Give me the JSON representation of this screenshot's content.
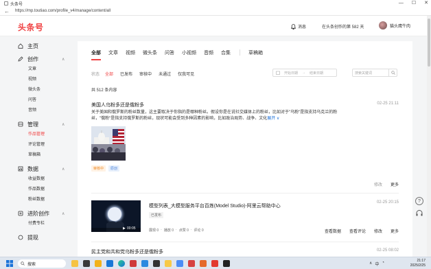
{
  "browser": {
    "tab_title": "头条号",
    "url": "https://mp.toutiao.com/profile_v4/manage/content/all",
    "controls": [
      "—",
      "☐",
      "✕"
    ]
  },
  "header": {
    "logo": "头条号",
    "messages": "消息",
    "days_text": "在头条创作的第 582 天",
    "username": "猫头鹰牛肉"
  },
  "sidebar": {
    "home": "主页",
    "create": {
      "label": "创作",
      "items": [
        "文章",
        "视频",
        "微头条",
        "问答",
        "音频"
      ]
    },
    "manage": {
      "label": "管理",
      "items": [
        "作品管理",
        "评论管理",
        "草稿箱"
      ]
    },
    "data": {
      "label": "数据",
      "items": [
        "收益数据",
        "作品数据",
        "粉丝数据"
      ]
    },
    "advanced": {
      "label": "进阶创作",
      "items": [
        "付费专栏"
      ]
    },
    "earn": {
      "label": "提现"
    }
  },
  "tabs": [
    "全部",
    "文章",
    "视频",
    "微头条",
    "问答",
    "小视频",
    "音频",
    "合集"
  ],
  "drafts_tab": "草稿箱",
  "filters": {
    "label": "状态",
    "items": [
      "全部",
      "已发布",
      "审核中",
      "未通过",
      "仅我可见"
    ],
    "date_start": "开始日期",
    "date_end": "结束日期",
    "search_placeholder": "搜索关键词"
  },
  "total": "共 512 条内容",
  "articles": [
    {
      "title": "美国人乌粉多还是俄粉多",
      "time": "02-25 21:11",
      "summary": "关于美国和俄罗斯的粉丝数量，这主要取决于你指的是哪种粉丝。假设你是在说社交媒体上的粉丝，比如对于\"乌粉\"是指支持乌克兰的粉丝，\"俄粉\"是指支持俄罗斯的粉丝，现状可能会受到多种因素的影响，比如政治局势、战争、文化",
      "expand": "展开 ∨",
      "tags": [
        "审核中",
        "原创"
      ],
      "ops": [
        "修改",
        "更多"
      ]
    },
    {
      "title": "模型列表_大模型服务平台百炼(Model Studio)-阿里云帮助中心",
      "time": "02-25 20:15",
      "status": "已发布",
      "duration": "00:05",
      "stats": [
        "展现 0",
        "播放 0",
        "点赞 0",
        "评论 0"
      ],
      "ops": [
        "查看数据",
        "查看评论",
        "修改",
        "更多"
      ]
    },
    {
      "title": "民主党和共和党乌粉多还是俄粉多",
      "time": "02-25 08:02"
    }
  ],
  "taskbar": {
    "search": "搜索",
    "time": "21:17",
    "date": "2025/2/25",
    "ime": "中"
  },
  "colors": {
    "accent": "#f04142",
    "link": "#1a6fd8"
  }
}
